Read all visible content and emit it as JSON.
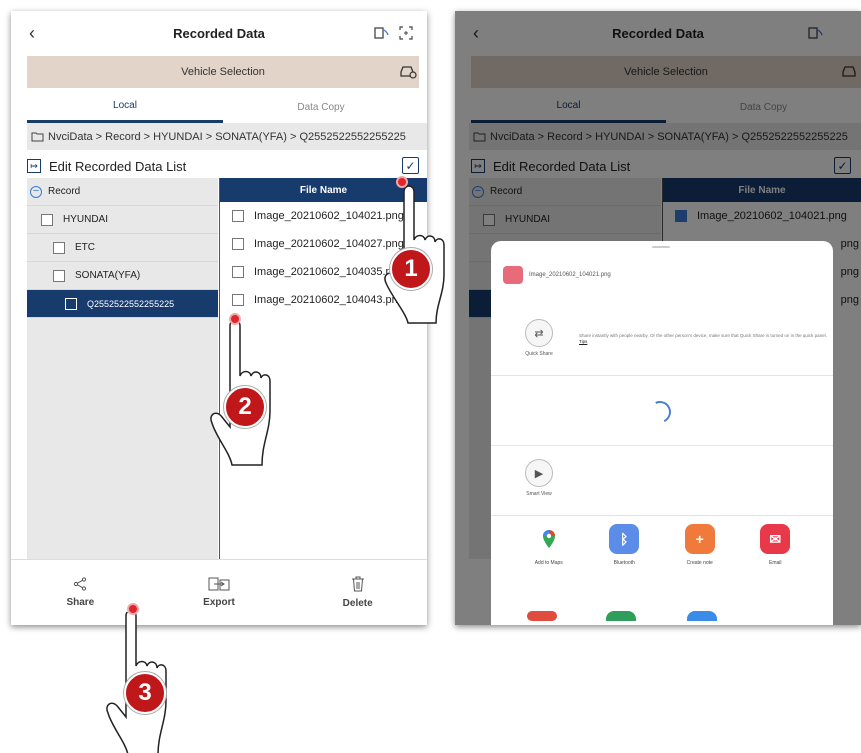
{
  "left": {
    "header": {
      "back": "‹",
      "title": "Recorded Data"
    },
    "vehicle_selection": "Vehicle Selection",
    "tabs": [
      {
        "label": "Local"
      },
      {
        "label": "Data Copy"
      }
    ],
    "breadcrumb": "NvciData > Record > HYUNDAI > SONATA(YFA) > Q2552522552255225",
    "edit_list_label": "Edit Recorded Data List",
    "tree": {
      "root": "Record",
      "items": [
        "HYUNDAI",
        "ETC",
        "SONATA(YFA)",
        "Q2552522552255225"
      ]
    },
    "files": {
      "header": "File Name",
      "rows": [
        "Image_20210602_104021.png",
        "Image_20210602_104027.png",
        "Image_20210602_104035.png",
        "Image_20210602_104043.png"
      ]
    },
    "bottom": {
      "share": "Share",
      "export": "Export",
      "delete": "Delete"
    }
  },
  "right": {
    "header": {
      "title": "Recorded Data"
    },
    "vehicle_selection": "Vehicle Selection",
    "tabs": [
      {
        "label": "Local"
      },
      {
        "label": "Data Copy"
      }
    ],
    "breadcrumb": "NvciData > Record > HYUNDAI > SONATA(YFA) > Q2552522552255225",
    "edit_list_label": "Edit Recorded Data List",
    "tree_root": "Record",
    "tree_item": "HYUNDAI",
    "file_header": "File Name",
    "file_row": "Image_20210602_104021.png",
    "file_row_tail": "png",
    "sheet": {
      "file_name": "Image_20210602_104021.png",
      "quick_share_label": "Quick Share",
      "quick_share_text": "Share instantly with people nearby. Or the other person's device, make sure that Quick Share is turned on in the quick panel.",
      "quick_share_tips": "Tips",
      "smart_view_label": "Smart View",
      "apps": [
        {
          "label": "Add to Maps",
          "color": "#ffffff",
          "icon": "maps-pin-icon"
        },
        {
          "label": "Bluetooth",
          "color": "#5b8ce8",
          "icon": "bluetooth-icon"
        },
        {
          "label": "Create note",
          "color": "#ef7a3b",
          "icon": "note-icon"
        },
        {
          "label": "Email",
          "color": "#e8394a",
          "icon": "email-icon"
        }
      ]
    }
  },
  "steps": [
    "1",
    "2",
    "3"
  ],
  "colors": {
    "navy": "#183b6e",
    "vehicle_bar": "#e2d4c9",
    "badge": "#c0171b"
  }
}
